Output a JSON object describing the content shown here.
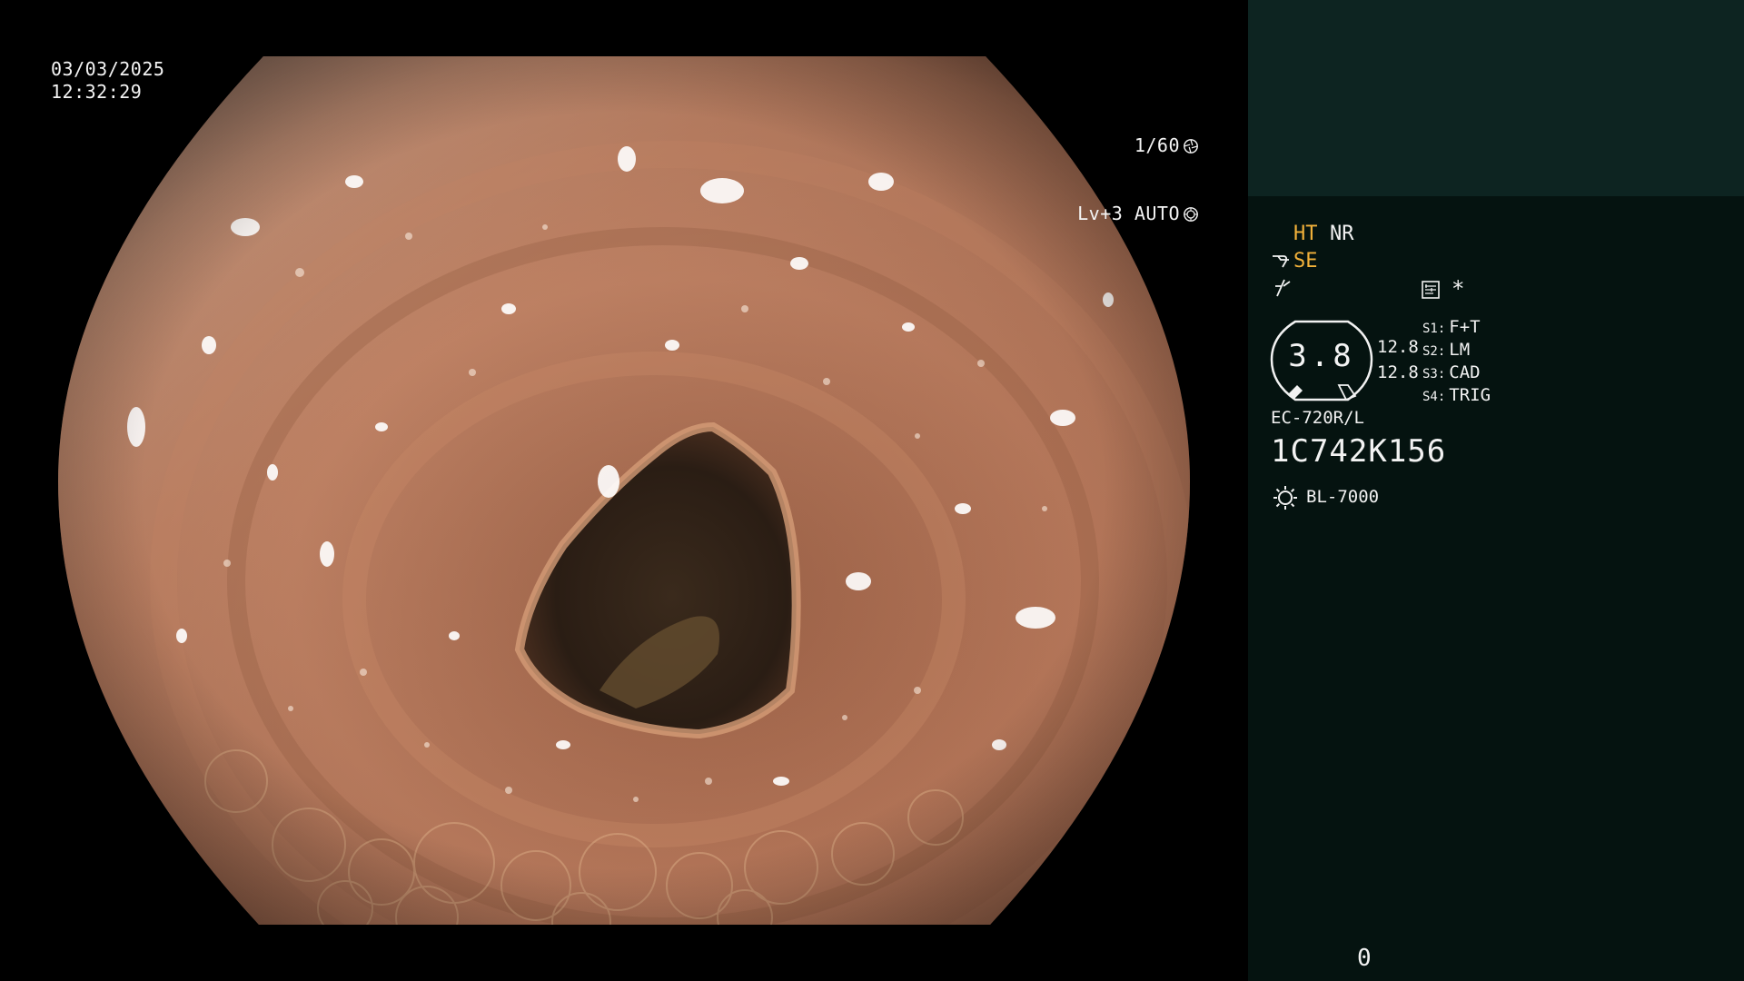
{
  "window": {
    "date": "03/03/2025",
    "time": "12:32:29"
  },
  "exposure": {
    "shutter": "1/60",
    "shutter_icon": "aperture-icon",
    "level": "Lv+3 AUTO",
    "auto_icon": "iris-icon"
  },
  "panel": {
    "ht": "HT",
    "nr": "NR",
    "se_icon": "structure-enhance-icon",
    "se": "SE",
    "f_icon": "freeze-icon",
    "memo_icon": "memo-icon",
    "asterisk": "*",
    "gauge": {
      "value": "3.8",
      "reading_a": "12.8",
      "reading_b": "12.8"
    },
    "switches": [
      {
        "key": "S1:",
        "value": "F+T"
      },
      {
        "key": "S2:",
        "value": "LM"
      },
      {
        "key": "S3:",
        "value": "CAD"
      },
      {
        "key": "S4:",
        "value": "TRIG"
      }
    ],
    "scope_model": "EC-720R/L",
    "scope_serial": "1C742K156",
    "light_icon": "light-source-icon",
    "light_model": "BL-7000",
    "counter": "0"
  },
  "colors": {
    "panel_bg": "#051310",
    "thumb_bg": "#0d2421",
    "accent": "#f2b13a",
    "text": "#f2f2f2"
  }
}
